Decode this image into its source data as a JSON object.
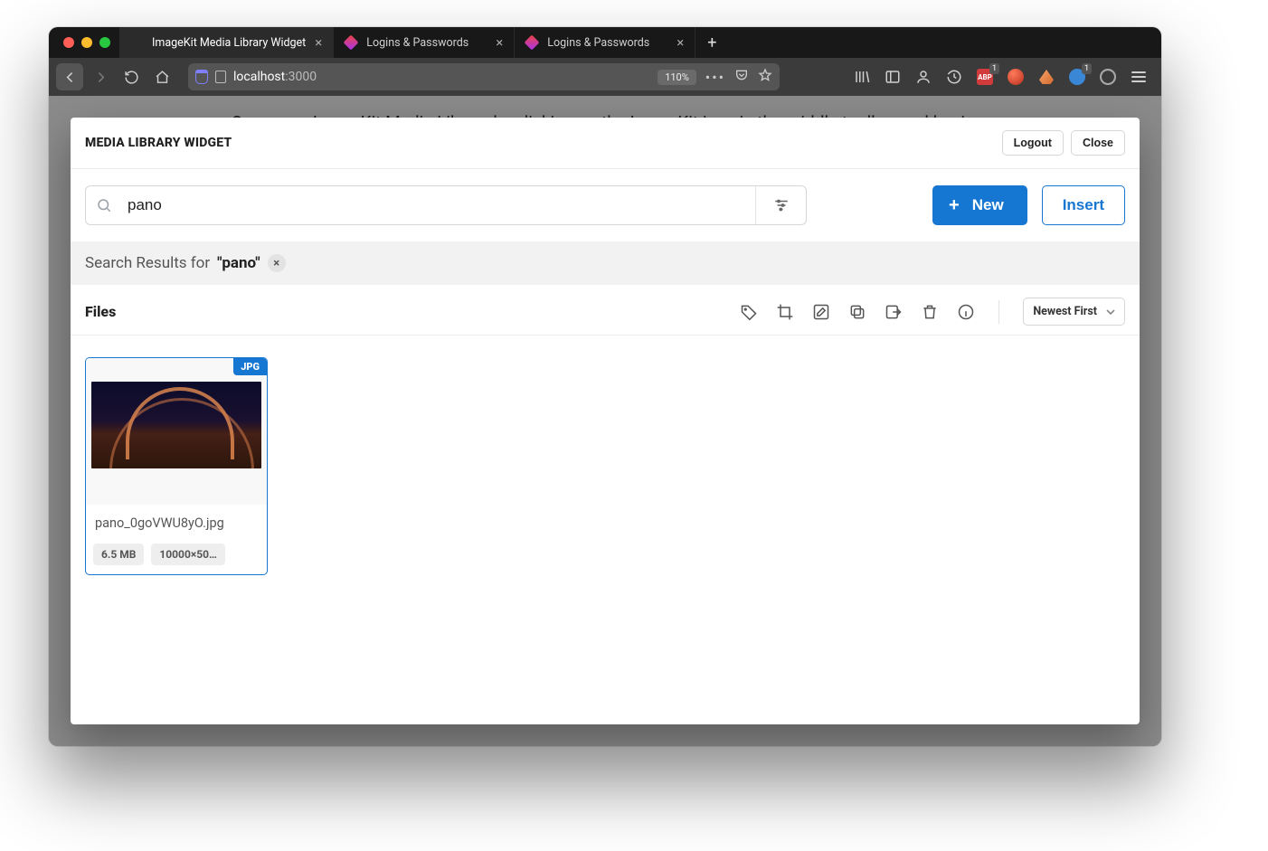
{
  "browser": {
    "tabs": [
      {
        "title": "ImageKit Media Library Widget",
        "active": true
      },
      {
        "title": "Logins & Passwords",
        "active": false
      },
      {
        "title": "Logins & Passwords",
        "active": false
      }
    ],
    "url_host": "localhost",
    "url_port": ":3000",
    "zoom": "110%",
    "ext_badges": {
      "abp": "1",
      "blue": "1"
    }
  },
  "page_hint": "Open your ImageKit Media Library by clicking on the ImageKit icon in the middle toolbar and log in.",
  "modal": {
    "title": "MEDIA LIBRARY WIDGET",
    "logout": "Logout",
    "close": "Close",
    "search_value": "pano",
    "new_label": "New",
    "insert_label": "Insert",
    "results_prefix": "Search Results for ",
    "results_query": "\"pano\"",
    "files_heading": "Files",
    "sort_label": "Newest First"
  },
  "files": [
    {
      "format": "JPG",
      "name": "pano_0goVWU8yO.jpg",
      "size": "6.5 MB",
      "dims": "10000×50…"
    }
  ]
}
